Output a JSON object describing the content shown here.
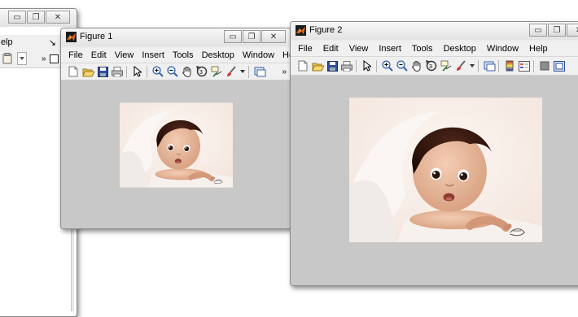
{
  "background_window": {
    "menu_partial": "elp",
    "overflow_glyph": "»",
    "pin_glyph": "↘"
  },
  "figure1": {
    "title": "Figure 1",
    "menu": [
      "File",
      "Edit",
      "View",
      "Insert",
      "Tools",
      "Desktop",
      "Window",
      "Help"
    ],
    "pin_glyph": "↘",
    "overflow_glyph": "»",
    "image_alt": "Baby wrapped in white towel"
  },
  "figure2": {
    "title": "Figure 2",
    "menu": [
      "File",
      "Edit",
      "View",
      "Insert",
      "Tools",
      "Desktop",
      "Window",
      "Help"
    ],
    "image_alt": "Baby wrapped in white towel, enlarged"
  },
  "colors": {
    "figure_background": "#c8c8c8",
    "matlab_logo": "#e0661b"
  },
  "icons": {
    "toolbar": [
      "new-figure-icon",
      "open-file-icon",
      "save-icon",
      "print-icon",
      "pointer-icon",
      "zoom-in-icon",
      "zoom-out-icon",
      "pan-icon",
      "rotate-3d-icon",
      "data-cursor-icon",
      "brush-icon",
      "link-icon",
      "colorbar-icon",
      "legend-icon",
      "hide-plot-tools-icon",
      "show-plot-tools-icon"
    ]
  }
}
